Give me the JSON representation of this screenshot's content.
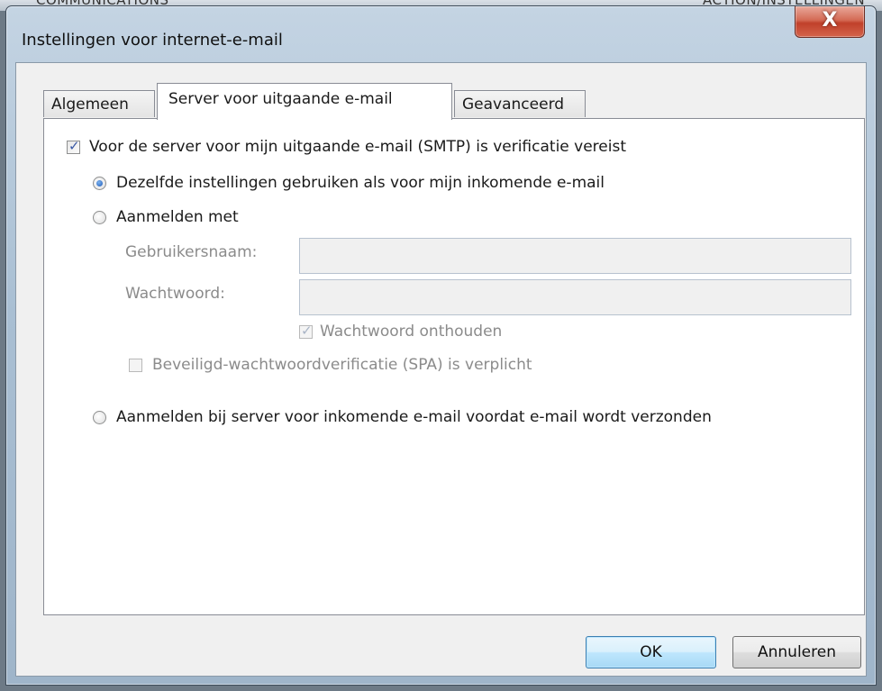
{
  "background": {
    "left_text": "COMMUNICATIONS",
    "right_text": "ACTION/INSTELLINGEN"
  },
  "window": {
    "title": "Instellingen voor internet-e-mail",
    "close_label": "X"
  },
  "tabs": [
    {
      "label": "Algemeen",
      "active": false
    },
    {
      "label": "Server voor uitgaande e-mail",
      "active": true
    },
    {
      "label": "Geavanceerd",
      "active": false
    }
  ],
  "outgoing": {
    "smtp_auth": {
      "label": "Voor de server voor mijn uitgaande e-mail (SMTP) is verificatie vereist",
      "checked": true
    },
    "same_settings": {
      "label": "Dezelfde instellingen gebruiken als voor mijn inkomende e-mail",
      "selected": true
    },
    "login_with": {
      "label": "Aanmelden met",
      "selected": false
    },
    "username": {
      "label": "Gebruikersnaam:",
      "value": ""
    },
    "password": {
      "label": "Wachtwoord:",
      "value": ""
    },
    "remember_password": {
      "label": "Wachtwoord onthouden",
      "checked": true,
      "enabled": false
    },
    "spa": {
      "label": "Beveiligd-wachtwoordverificatie (SPA) is verplicht",
      "checked": false,
      "enabled": false
    },
    "login_incoming_first": {
      "label": "Aanmelden bij server voor inkomende e-mail voordat e-mail wordt verzonden",
      "selected": false
    }
  },
  "buttons": {
    "ok": "OK",
    "cancel": "Annuleren"
  },
  "colors": {
    "accent": "#3a58a5",
    "close_button": "#c0402a",
    "default_button": "#bee6fd"
  }
}
